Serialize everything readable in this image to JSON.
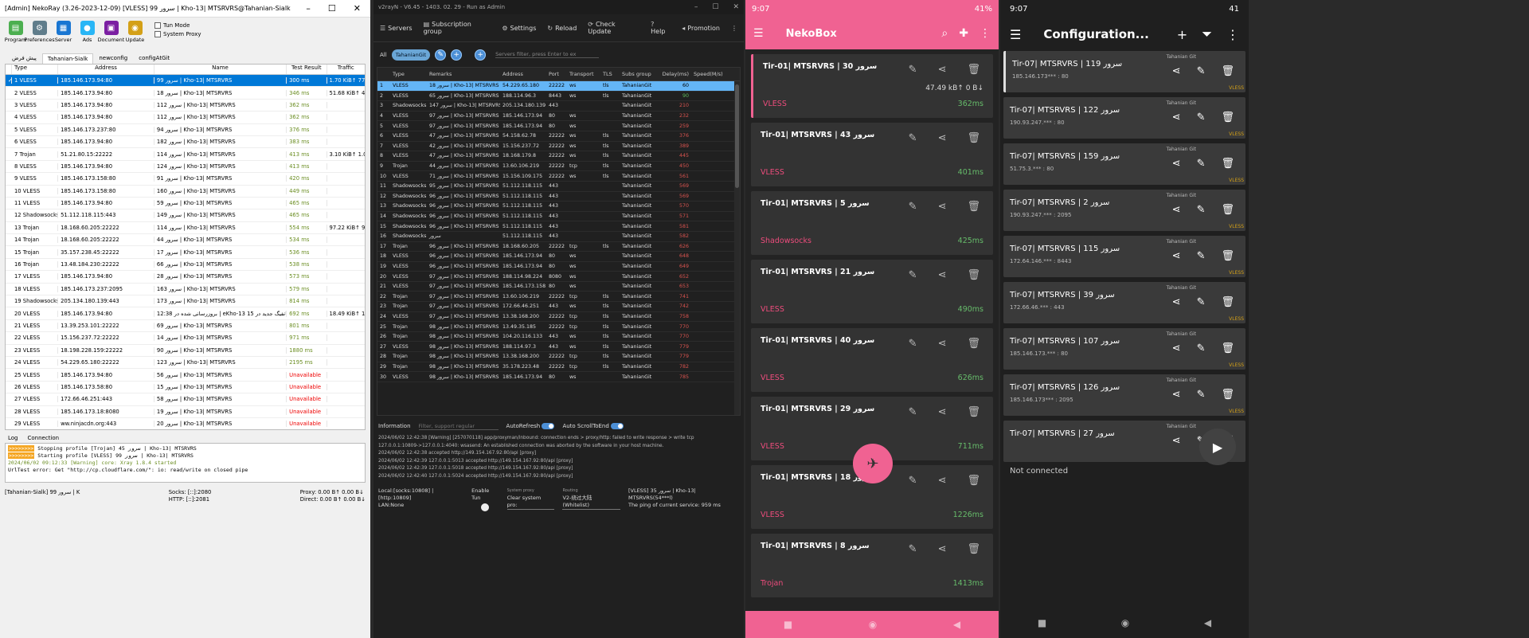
{
  "nekoray": {
    "title": "[Admin] NekoRay (3.26-2023-12-09) [VLESS] سرور 99 | Kho-13| MTSRVRS@Tahanian-Sialk",
    "toolbar": [
      "Program",
      "Preferences",
      "Server",
      "Ads",
      "Document",
      "Update"
    ],
    "checks": [
      "Tun Mode",
      "System Proxy"
    ],
    "tabs": [
      "پیش فرض",
      "Tahanian-Sialk",
      "newconfig",
      "configAtGit"
    ],
    "headers": [
      "Type",
      "Address",
      "Name",
      "Test Result",
      "Traffic"
    ],
    "rows": [
      [
        "1",
        "VLESS",
        "185.146.173.94:80",
        "سرور 99 | Kho-13| MTSRVRS",
        "300 ms",
        "1.70 KiB↑ 778.00 B↓"
      ],
      [
        "2",
        "VLESS",
        "185.146.173.94:80",
        "سرور 18 | Kho-13| MTSRVRS",
        "346 ms",
        "51.68 KiB↑ 48.12 KiB"
      ],
      [
        "3",
        "VLESS",
        "185.146.173.94:80",
        "سرور 112 | Kho-13| MTSRVRS",
        "362 ms",
        ""
      ],
      [
        "4",
        "VLESS",
        "185.146.173.94:80",
        "سرور 112 | Kho-13| MTSRVRS",
        "362 ms",
        ""
      ],
      [
        "5",
        "VLESS",
        "185.146.173.237:80",
        "سرور 94 | Kho-13| MTSRVRS",
        "376 ms",
        ""
      ],
      [
        "6",
        "VLESS",
        "185.146.173.94:80",
        "سرور 182 | Kho-13| MTSRVRS",
        "383 ms",
        ""
      ],
      [
        "7",
        "Trojan",
        "51.21.80.15:22222",
        "سرور 114 | Kho-13| MTSRVRS",
        "413 ms",
        "3.10 KiB↑ 1.02 KiB↓"
      ],
      [
        "8",
        "VLESS",
        "185.146.173.94:80",
        "سرور 124 | Kho-13| MTSRVRS",
        "413 ms",
        ""
      ],
      [
        "9",
        "VLESS",
        "185.146.173.158:80",
        "سرور 91 | Kho-13| MTSRVRS",
        "420 ms",
        ""
      ],
      [
        "10",
        "VLESS",
        "185.146.173.158:80",
        "سرور 160 | Kho-13| MTSRVRS",
        "449 ms",
        ""
      ],
      [
        "11",
        "VLESS",
        "185.146.173.94:80",
        "سرور 59 | Kho-13| MTSRVRS",
        "465 ms",
        ""
      ],
      [
        "12",
        "Shadowsocks",
        "51.112.118.115:443",
        "سرور 149 | Kho-13| MTSRVRS",
        "465 ms",
        ""
      ],
      [
        "13",
        "Trojan",
        "18.168.60.205:22222",
        "سرور 114 | Kho-13| MTSRVRS",
        "554 ms",
        "97.22 KiB↑ 90.02 KiB"
      ],
      [
        "14",
        "Trojan",
        "18.168.60.205:22222",
        "سرور 44 | Kho-13| MTSRVRS",
        "534 ms",
        ""
      ],
      [
        "15",
        "Trojan",
        "35.157.238.45:22222",
        "سرور 17 | Kho-13| MTSRVRS",
        "536 ms",
        ""
      ],
      [
        "16",
        "Trojan",
        "13.48.184.230:22222",
        "سرور 66 | Kho-13| MTSRVRS",
        "538 ms",
        ""
      ],
      [
        "17",
        "VLESS",
        "185.146.173.94:80",
        "سرور 28 | Kho-13| MTSRVRS",
        "573 ms",
        ""
      ],
      [
        "18",
        "VLESS",
        "185.146.173.237:2095",
        "سرور 163 | Kho-13| MTSRVRS",
        "579 ms",
        ""
      ],
      [
        "19",
        "Shadowsocks",
        "205.134.180.139:443",
        "سرور 173 | Kho-13| MTSRVRS",
        "814 ms",
        ""
      ],
      [
        "20",
        "VLESS",
        "185.146.173.94:80",
        "بروزرسانی شده در 12:38 | eKho-13 دقیقه کانفیگ جدید در 15",
        "692 ms",
        "18.49 KiB↑ 19.26 KiB"
      ],
      [
        "21",
        "VLESS",
        "13.39.253.101:22222",
        "سرور 69 | Kho-13| MTSRVRS",
        "801 ms",
        ""
      ],
      [
        "22",
        "VLESS",
        "15.156.237.72:22222",
        "سرور 14 | Kho-13| MTSRVRS",
        "971 ms",
        ""
      ],
      [
        "23",
        "VLESS",
        "18.198.228.159:22222",
        "سرور 90 | Kho-13| MTSRVRS",
        "1880 ms",
        ""
      ],
      [
        "24",
        "VLESS",
        "54.229.65.180:22222",
        "سرور 123 | Kho-13| MTSRVRS",
        "2195 ms",
        ""
      ],
      [
        "25",
        "VLESS",
        "185.146.173.94:80",
        "سرور 56 | Kho-13| MTSRVRS",
        "Unavailable",
        ""
      ],
      [
        "26",
        "VLESS",
        "185.146.173.58:80",
        "سرور 15 | Kho-13| MTSRVRS",
        "Unavailable",
        ""
      ],
      [
        "27",
        "VLESS",
        "172.66.46.251:443",
        "سرور 58 | Kho-13| MTSRVRS",
        "Unavailable",
        ""
      ],
      [
        "28",
        "VLESS",
        "185.146.173.18:8080",
        "سرور 19 | Kho-13| MTSRVRS",
        "Unavailable",
        ""
      ],
      [
        "29",
        "VLESS",
        "ww.ninjacdn.org:443",
        "سرور 20 | Kho-13| MTSRVRS",
        "Unavailable",
        ""
      ]
    ],
    "log_tabs": [
      "Log",
      "Connection"
    ],
    "log": [
      "Stopping profile [Trojan] سرور 45 | Kho-13| MTSRVRS",
      "Starting profile [VLESS] سرور 99 | Kho-13| MTSRVRS",
      "2024/06/02 09:12:33 [Warning] core: Xray 1.8.4 started",
      "UrlTest error: Get \"http://cp.cloudflare.com/\": io: read/write on closed pipe"
    ],
    "log_prefix": ">>>>>>>>",
    "status": {
      "profile": "[Tahanian-Sialk] سرور 99 | K",
      "socks": "Socks: [::]:2080",
      "http": "HTTP: [::]:2081",
      "proxy": "Proxy: 0.00 B↑ 0.00 B↓",
      "direct": "Direct: 0.00 B↑ 0.00 B↓"
    }
  },
  "v2rayn": {
    "title": "v2rayN - V6.45 - 1403. 02. 29 - Run as Admin",
    "menu": [
      "Servers",
      "Subscription group",
      "Settings",
      "Reload",
      "Check Update",
      "Help",
      "Promotion"
    ],
    "filter_all": "All",
    "chip": "TahanianGit",
    "search_placeholder": "Servers filter, press Enter to ex",
    "headers": [
      "",
      "Type",
      "Remarks",
      "Address",
      "Port",
      "Transport",
      "TLS",
      "Subs group",
      "Delay(ms)",
      "Speed(M/s)"
    ],
    "rows": [
      [
        "1",
        "VLESS",
        "سرور 18 | Kho-13| MTSRVRS",
        "54.229.65.180",
        "22222",
        "ws",
        "tls",
        "TahanianGit",
        "60"
      ],
      [
        "2",
        "VLESS",
        "سرور 65 | Kho-13| MTSRVRS",
        "188.114.96.3",
        "8443",
        "ws",
        "tls",
        "TahanianGit",
        "90"
      ],
      [
        "3",
        "Shadowsocks",
        "سرور 147 | Kho-13| MTSRVRS",
        "205.134.180.139",
        "443",
        "",
        "",
        "TahanianGit",
        "210"
      ],
      [
        "4",
        "VLESS",
        "سرور 97 | Kho-13| MTSRVRS",
        "185.146.173.94",
        "80",
        "ws",
        "",
        "TahanianGit",
        "232"
      ],
      [
        "5",
        "VLESS",
        "سرور 97 | Kho-13| MTSRVRS",
        "185.146.173.94",
        "80",
        "ws",
        "",
        "TahanianGit",
        "259"
      ],
      [
        "6",
        "VLESS",
        "سرور 47 | Kho-13| MTSRVRS",
        "54.158.62.78",
        "22222",
        "ws",
        "tls",
        "TahanianGit",
        "376"
      ],
      [
        "7",
        "VLESS",
        "سرور 42 | Kho-13| MTSRVRS",
        "15.156.237.72",
        "22222",
        "ws",
        "tls",
        "TahanianGit",
        "389"
      ],
      [
        "8",
        "VLESS",
        "سرور 47 | Kho-13| MTSRVRS",
        "18.168.179.8",
        "22222",
        "ws",
        "tls",
        "TahanianGit",
        "445"
      ],
      [
        "9",
        "Trojan",
        "سرور 44 | Kho-13| MTSRVRS",
        "13.60.106.219",
        "22222",
        "tcp",
        "tls",
        "TahanianGit",
        "450"
      ],
      [
        "10",
        "VLESS",
        "سرور 71 | Kho-13| MTSRVRS",
        "15.156.109.175",
        "22222",
        "ws",
        "tls",
        "TahanianGit",
        "561"
      ],
      [
        "11",
        "Shadowsocks",
        "سرور 95 | Kho-13| MTSRVRS",
        "51.112.118.115",
        "443",
        "",
        "",
        "TahanianGit",
        "569"
      ],
      [
        "12",
        "Shadowsocks",
        "سرور 96 | Kho-13| MTSRVRS",
        "51.112.118.115",
        "443",
        "",
        "",
        "TahanianGit",
        "569"
      ],
      [
        "13",
        "Shadowsocks",
        "سرور 96 | Kho-13| MTSRVRS",
        "51.112.118.115",
        "443",
        "",
        "",
        "TahanianGit",
        "570"
      ],
      [
        "14",
        "Shadowsocks",
        "سرور 96 | Kho-13| MTSRVRS",
        "51.112.118.115",
        "443",
        "",
        "",
        "TahanianGit",
        "571"
      ],
      [
        "15",
        "Shadowsocks",
        "سرور 96 | Kho-13| MTSRVRS",
        "51.112.118.115",
        "443",
        "",
        "",
        "TahanianGit",
        "581"
      ],
      [
        "16",
        "Shadowsocks",
        "سرور",
        "51.112.118.115",
        "443",
        "",
        "",
        "TahanianGit",
        "582"
      ],
      [
        "17",
        "Trojan",
        "سرور 96 | Kho-13| MTSRVRS",
        "18.168.60.205",
        "22222",
        "tcp",
        "tls",
        "TahanianGit",
        "626"
      ],
      [
        "18",
        "VLESS",
        "سرور 96 | Kho-13| MTSRVRS",
        "185.146.173.94",
        "80",
        "ws",
        "",
        "TahanianGit",
        "648"
      ],
      [
        "19",
        "VLESS",
        "سرور 96 | Kho-13| MTSRVRS",
        "185.146.173.94",
        "80",
        "ws",
        "",
        "TahanianGit",
        "649"
      ],
      [
        "20",
        "VLESS",
        "سرور 97 | Kho-13| MTSRVRS",
        "188.114.98.224",
        "8080",
        "ws",
        "",
        "TahanianGit",
        "652"
      ],
      [
        "21",
        "VLESS",
        "سرور 97 | Kho-13| MTSRVRS",
        "185.146.173.158",
        "80",
        "ws",
        "",
        "TahanianGit",
        "653"
      ],
      [
        "22",
        "Trojan",
        "سرور 97 | Kho-13| MTSRVRS",
        "13.60.106.219",
        "22222",
        "tcp",
        "tls",
        "TahanianGit",
        "741"
      ],
      [
        "23",
        "Trojan",
        "سرور 97 | Kho-13| MTSRVRS",
        "172.66.46.251",
        "443",
        "ws",
        "tls",
        "TahanianGit",
        "742"
      ],
      [
        "24",
        "VLESS",
        "سرور 97 | Kho-13| MTSRVRS",
        "13.38.168.200",
        "22222",
        "tcp",
        "tls",
        "TahanianGit",
        "758"
      ],
      [
        "25",
        "Trojan",
        "سرور 98 | Kho-13| MTSRVRS",
        "13.49.35.185",
        "22222",
        "tcp",
        "tls",
        "TahanianGit",
        "770"
      ],
      [
        "26",
        "Trojan",
        "سرور 98 | Kho-13| MTSRVRS",
        "104.20.116.133",
        "443",
        "ws",
        "tls",
        "TahanianGit",
        "770"
      ],
      [
        "27",
        "VLESS",
        "سرور 98 | Kho-13| MTSRVRS",
        "188.114.97.3",
        "443",
        "ws",
        "tls",
        "TahanianGit",
        "779"
      ],
      [
        "28",
        "Trojan",
        "سرور 98 | Kho-13| MTSRVRS",
        "13.38.168.200",
        "22222",
        "tcp",
        "tls",
        "TahanianGit",
        "779"
      ],
      [
        "29",
        "Trojan",
        "سرور 98 | Kho-13| MTSRVRS",
        "35.178.223.48",
        "22222",
        "tcp",
        "tls",
        "TahanianGit",
        "782"
      ],
      [
        "30",
        "VLESS",
        "سرور 98 | Kho-13| MTSRVRS",
        "185.146.173.94",
        "80",
        "ws",
        "",
        "TahanianGit",
        "785"
      ]
    ],
    "info_label": "Information",
    "info_filter": "Filter, support regular",
    "auto_refresh": "AutoRefresh",
    "auto_scroll": "Auto ScrollToEnd",
    "log": [
      "2024/06/02 12:42:38 [Warning] [257070118] app/proxyman/inbound: connection ends > proxy/http: failed to write response > write tcp",
      "127.0.0.1:10809->127.0.0.1:4040: wsasend: An established connection was aborted by the software in your host machine.",
      "2024/06/02 12:42:38 accepted http://149.154.167.92:80/api [proxy]",
      "2024/06/02 12:42:39 127.0.0.1:5013 accepted http://149.154.167.92:80/api [proxy]",
      "2024/06/02 12:42:39 127.0.0.1:5018 accepted http://149.154.167.92:80/api [proxy]",
      "2024/06/02 12:42:40 127.0.0.1:5024 accepted http://149.154.167.92:80/api [proxy]"
    ],
    "status": {
      "local": "Local:[socks:10808] | [http:10809]",
      "lan": "LAN:None",
      "tun": "Enable Tun",
      "sys_label": "System proxy",
      "sys_val": "Clear system pro:",
      "route_label": "Routing",
      "route_val": "V2-绕过大陆(Whitelist)",
      "server": "[VLESS] سرور 35 | Kho-13| MTSRVRS(54***l)",
      "ping": "The ping of current service: 959 ms"
    }
  },
  "nekobox": {
    "time": "9:07",
    "battery": "41%",
    "title": "NekoBox",
    "cards": [
      {
        "name": "Tir-01| MTSRVRS | سرور 30",
        "type": "VLESS",
        "lat": "362ms",
        "traffic": "47.49 kB↑ 0 B↓"
      },
      {
        "name": "Tir-01| MTSRVRS | سرور 43",
        "type": "VLESS",
        "lat": "401ms"
      },
      {
        "name": "Tir-01| MTSRVRS | سرور 5",
        "type": "Shadowsocks",
        "lat": "425ms"
      },
      {
        "name": "Tir-01| MTSRVRS | سرور 21",
        "type": "VLESS",
        "lat": "490ms"
      },
      {
        "name": "Tir-01| MTSRVRS | سرور 40",
        "type": "VLESS",
        "lat": "626ms"
      },
      {
        "name": "Tir-01| MTSRVRS | سرور 29",
        "type": "VLESS",
        "lat": "711ms"
      },
      {
        "name": "Tir-01| MTSRVRS | سرور 18",
        "type": "VLESS",
        "lat": "1226ms"
      },
      {
        "name": "Tir-01| MTSRVRS | سرور 8",
        "type": "Trojan",
        "lat": "1413ms"
      }
    ]
  },
  "config": {
    "time": "9:07",
    "battery": "41",
    "title": "Configuration...",
    "status": "Not connected",
    "sub": "Tahanian Git",
    "cards": [
      {
        "name": "Tir-07| MTSRVRS | سرور 119",
        "addr": "185.146.173*** : 80",
        "type": "VLESS"
      },
      {
        "name": "Tir-07| MTSRVRS | سرور 122",
        "addr": "190.93.247.*** : 80",
        "type": "VLESS"
      },
      {
        "name": "Tir-07| MTSRVRS | سرور 159",
        "addr": "51.75.3.*** : 80",
        "type": "VLESS"
      },
      {
        "name": "Tir-07| MTSRVRS | سرور 2",
        "addr": "190.93.247.*** : 2095",
        "type": "VLESS"
      },
      {
        "name": "Tir-07| MTSRVRS | سرور 115",
        "addr": "172.64.146.*** : 8443",
        "type": "VLESS"
      },
      {
        "name": "Tir-07| MTSRVRS | سرور 39",
        "addr": "172.66.46.*** : 443",
        "type": "VLESS"
      },
      {
        "name": "Tir-07| MTSRVRS | سرور 107",
        "addr": "185.146.173.*** : 80",
        "type": "VLESS"
      },
      {
        "name": "Tir-07| MTSRVRS | سرور 126",
        "addr": "185.146.173*** : 2095",
        "type": "VLESS"
      },
      {
        "name": "Tir-07| MTSRVRS | سرور 27",
        "addr": "",
        "type": ""
      }
    ]
  }
}
